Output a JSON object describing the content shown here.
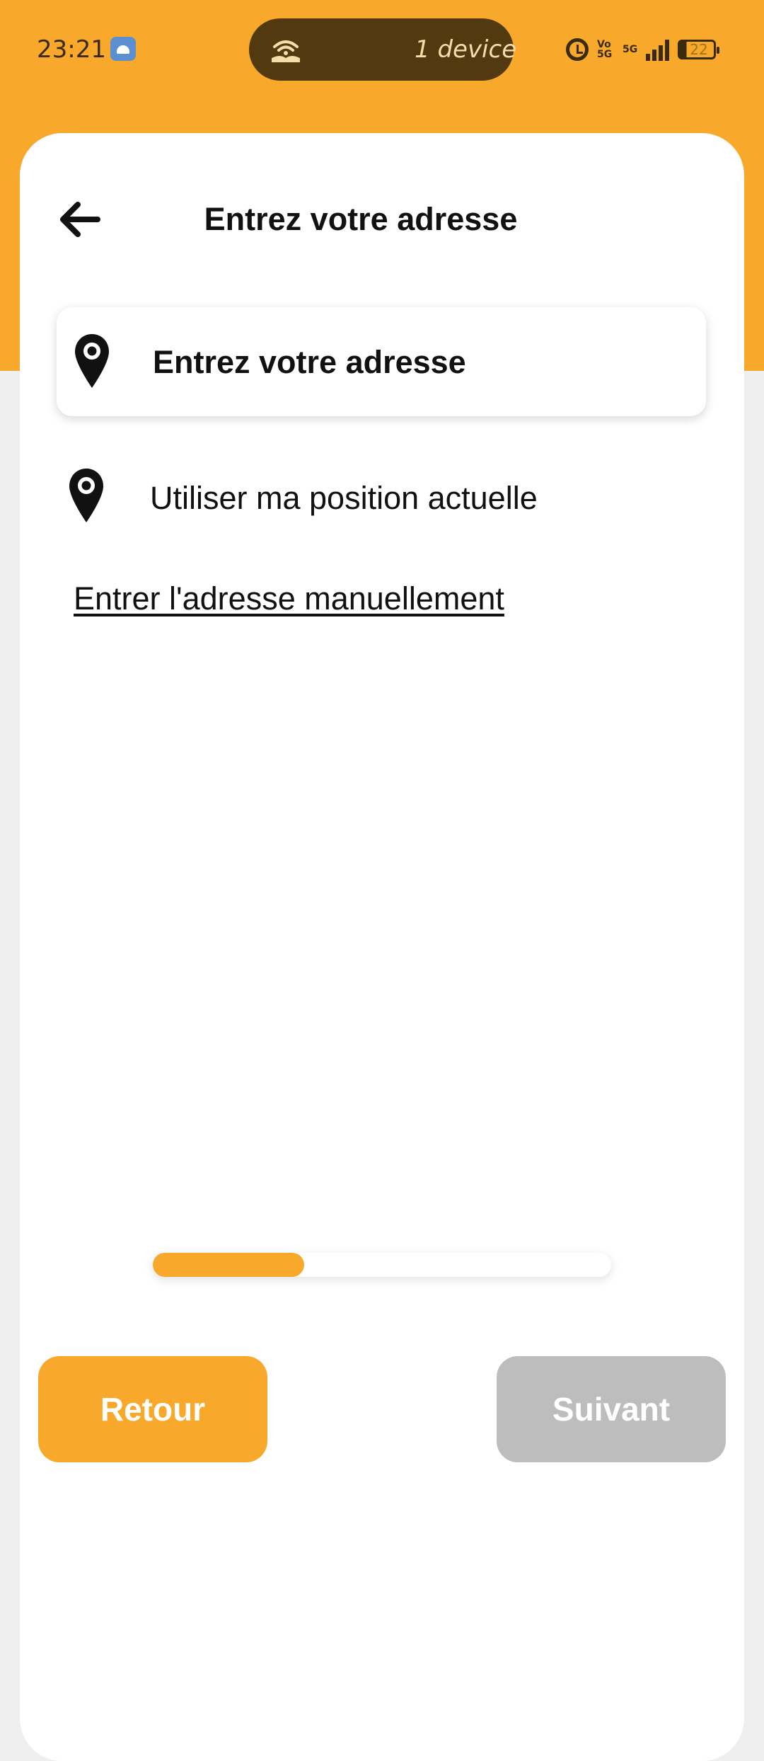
{
  "status_bar": {
    "time": "23:21",
    "hotspot_text": "1 device",
    "volte_label": "Vo 5G",
    "network_label": "5G",
    "battery_level": "22"
  },
  "header": {
    "title": "Entrez votre adresse",
    "back_icon": "arrow-left-icon"
  },
  "address_input": {
    "placeholder": "Entrez votre adresse",
    "icon": "location-pin-icon"
  },
  "use_location": {
    "label": "Utiliser ma position actuelle",
    "icon": "location-pin-icon"
  },
  "manual_link": {
    "label": "Entrer l'adresse manuellement"
  },
  "progress": {
    "value": 0.33
  },
  "buttons": {
    "back_label": "Retour",
    "next_label": "Suivant"
  },
  "colors": {
    "accent": "#f8a82a",
    "disabled": "#bdbdbd",
    "status_pill": "#52390f"
  }
}
